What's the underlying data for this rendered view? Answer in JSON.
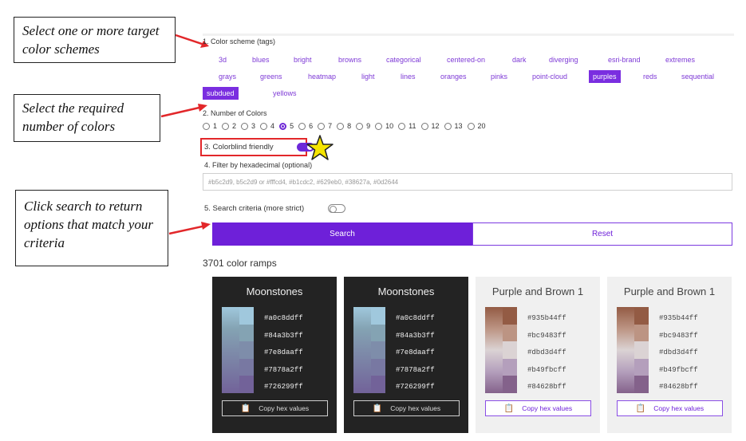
{
  "callouts": {
    "select_schemes": "Select one or more target color schemes",
    "select_colors": "Select the required number of colors",
    "click_search": "Click search to return options that match your criteria"
  },
  "section1": {
    "label": "1. Color scheme (tags)",
    "tags": [
      "3d",
      "blues",
      "bright",
      "browns",
      "categorical",
      "centered-on",
      "dark",
      "diverging",
      "esri-brand",
      "extremes",
      "grays",
      "greens",
      "heatmap",
      "light",
      "lines",
      "oranges",
      "pinks",
      "point-cloud",
      "purples",
      "reds",
      "sequential",
      "subdued",
      "yellows"
    ],
    "selected": [
      "purples",
      "subdued"
    ]
  },
  "section2": {
    "label": "2. Number of Colors",
    "options": [
      "1",
      "2",
      "3",
      "4",
      "5",
      "6",
      "7",
      "8",
      "9",
      "10",
      "11",
      "12",
      "13",
      "20"
    ],
    "selected": "5"
  },
  "section3": {
    "label": "3. Colorblind friendly",
    "enabled": true
  },
  "section4": {
    "label": "4. Filter by hexadecimal (optional)",
    "placeholder": "#b5c2d9, b5c2d9 or #fffcd4, #b1cdc2, #629eb0, #38627a, #0d2644"
  },
  "section5": {
    "label": "5. Search criteria (more strict)",
    "enabled": false
  },
  "buttons": {
    "search": "Search",
    "reset": "Reset"
  },
  "result_count": "3701 color ramps",
  "copy_label": "Copy hex values",
  "cards": [
    {
      "title": "Moonstones",
      "theme": "dark",
      "hex": [
        "#a0c8ddff",
        "#84a3b3ff",
        "#7e8daaff",
        "#7878a2ff",
        "#726299ff"
      ],
      "colors": [
        "#a0c8dd",
        "#84a3b3",
        "#7e8daa",
        "#7878a2",
        "#726299"
      ]
    },
    {
      "title": "Moonstones",
      "theme": "dark",
      "hex": [
        "#a0c8ddff",
        "#84a3b3ff",
        "#7e8daaff",
        "#7878a2ff",
        "#726299ff"
      ],
      "colors": [
        "#a0c8dd",
        "#84a3b3",
        "#7e8daa",
        "#7878a2",
        "#726299"
      ]
    },
    {
      "title": "Purple and Brown 1",
      "theme": "light",
      "hex": [
        "#935b44ff",
        "#bc9483ff",
        "#dbd3d4ff",
        "#b49fbcff",
        "#84628bff"
      ],
      "colors": [
        "#935b44",
        "#bc9483",
        "#dbd3d4",
        "#b49fbc",
        "#84628b"
      ]
    },
    {
      "title": "Purple and Brown 1",
      "theme": "light",
      "hex": [
        "#935b44ff",
        "#bc9483ff",
        "#dbd3d4ff",
        "#b49fbcff",
        "#84628bff"
      ],
      "colors": [
        "#935b44",
        "#bc9483",
        "#dbd3d4",
        "#b49fbc",
        "#84628b"
      ]
    }
  ],
  "colors": {
    "accent": "#6e20d9",
    "arrow": "#e2272a",
    "star": "#f5e400"
  }
}
